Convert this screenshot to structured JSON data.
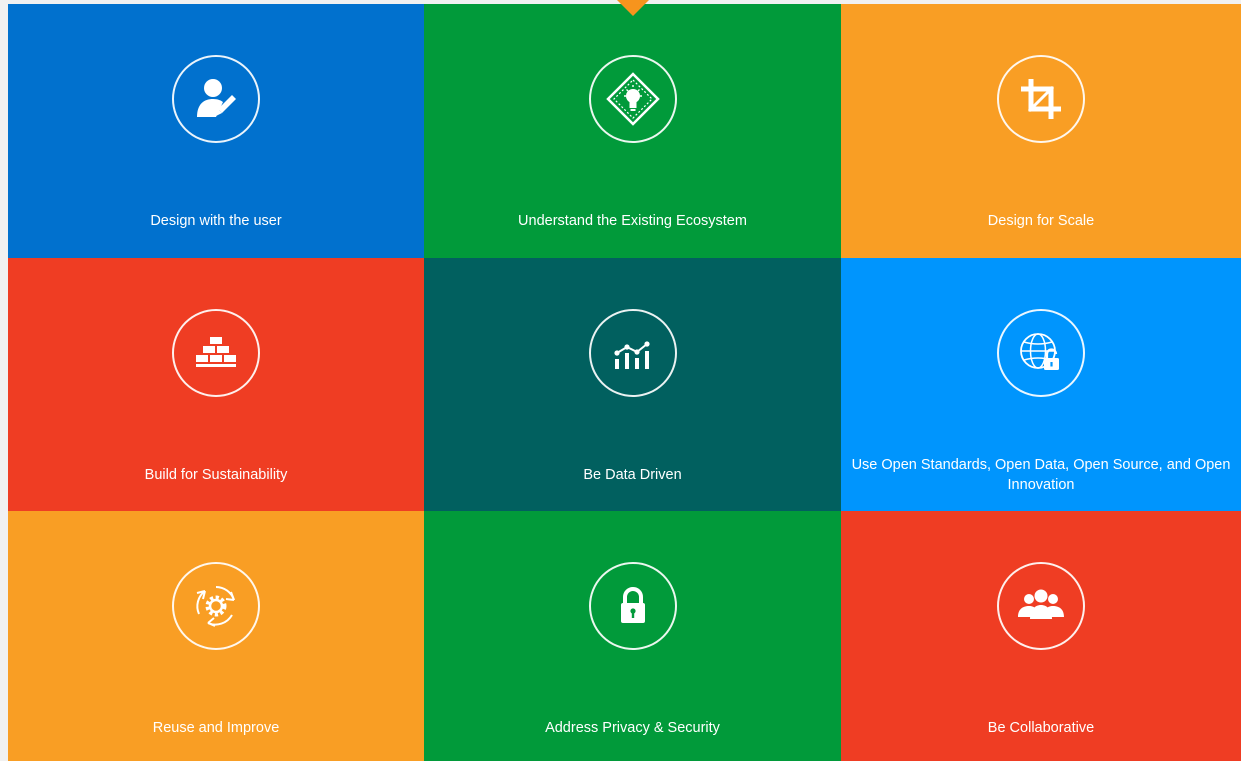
{
  "colors": {
    "blue": "#0171ce",
    "green": "#019a3a",
    "orange": "#f99e24",
    "red": "#ef3d23",
    "teal": "#01605f",
    "lightblue": "#0095fd",
    "pointer": "#f7941d"
  },
  "tiles": [
    {
      "label": "Design with the user",
      "icon": "user-design-icon",
      "color": "#0171ce"
    },
    {
      "label": "Understand the Existing Ecosystem",
      "icon": "lightbulb-diamond-icon",
      "color": "#019a3a"
    },
    {
      "label": "Design for Scale",
      "icon": "crop-icon",
      "color": "#f99e24"
    },
    {
      "label": "Build for Sustainability",
      "icon": "bricks-icon",
      "color": "#ef3d23"
    },
    {
      "label": "Be Data Driven",
      "icon": "data-chart-icon",
      "color": "#01605f"
    },
    {
      "label": "Use Open Standards, Open Data, Open Source, and Open Innovation",
      "icon": "globe-unlock-icon",
      "color": "#0095fd"
    },
    {
      "label": "Reuse and Improve",
      "icon": "gear-cycle-icon",
      "color": "#f99e24"
    },
    {
      "label": "Address Privacy & Security",
      "icon": "padlock-icon",
      "color": "#019a3a"
    },
    {
      "label": "Be Collaborative",
      "icon": "people-group-icon",
      "color": "#ef3d23"
    }
  ]
}
